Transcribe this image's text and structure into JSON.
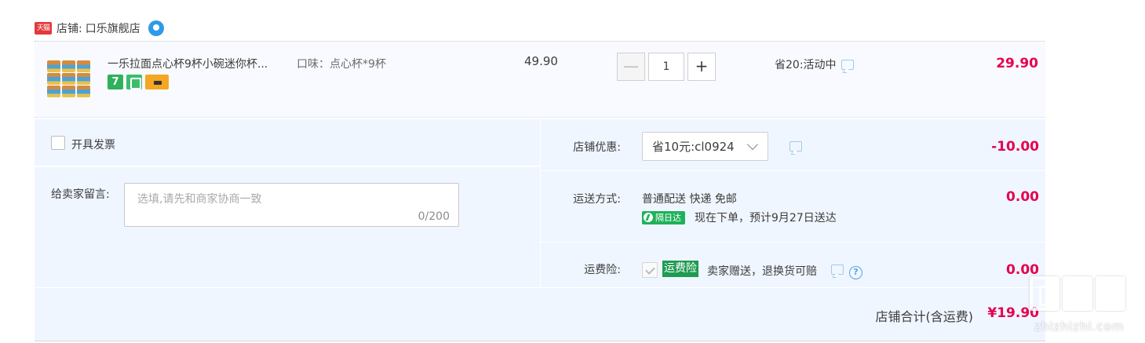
{
  "shop": {
    "badge_text": "天猫",
    "label": "店铺:",
    "name": "口乐旗舰店",
    "chat_icon": "wangwang-chat-icon"
  },
  "item": {
    "title": "一乐拉面点心杯9杯小碗迷你杯...",
    "flavor": "口味：点心杯*9杯",
    "badge_7": "7",
    "badges": [
      "seven-day-return-icon",
      "quality-guarantee-icon",
      "credit-card-icon"
    ],
    "unit_price": "49.90",
    "quantity": "1",
    "minus_label": "—",
    "plus_label": "+",
    "promo": "省20:活动中",
    "subtotal": "29.90"
  },
  "invoice": {
    "label": "开具发票",
    "checked": false
  },
  "note": {
    "label": "给卖家留言:",
    "placeholder": "选填,请先和商家协商一致",
    "counter": "0/200"
  },
  "coupon": {
    "label": "店铺优惠:",
    "selected": "省10元:cl0924",
    "amount": "-10.00"
  },
  "shipping": {
    "label": "运送方式:",
    "method": "普通配送 快递 免邮",
    "badge": "隔日达",
    "eta": "现在下单，预计9月27日送达",
    "amount": "0.00"
  },
  "insurance": {
    "label": "运费险:",
    "tag": "运费险",
    "text": "卖家赠送，退换货可赔",
    "help": "?",
    "amount": "0.00"
  },
  "total": {
    "label": "店铺合计(含运费)",
    "value": "¥19.90"
  },
  "watermark": {
    "text": "zhizhizhi.com"
  },
  "colors": {
    "price_red": "#e5004f",
    "panel_bg": "#f0f6ff",
    "tmall_red": "#e4393c",
    "insurance_green": "#1f9b52"
  }
}
